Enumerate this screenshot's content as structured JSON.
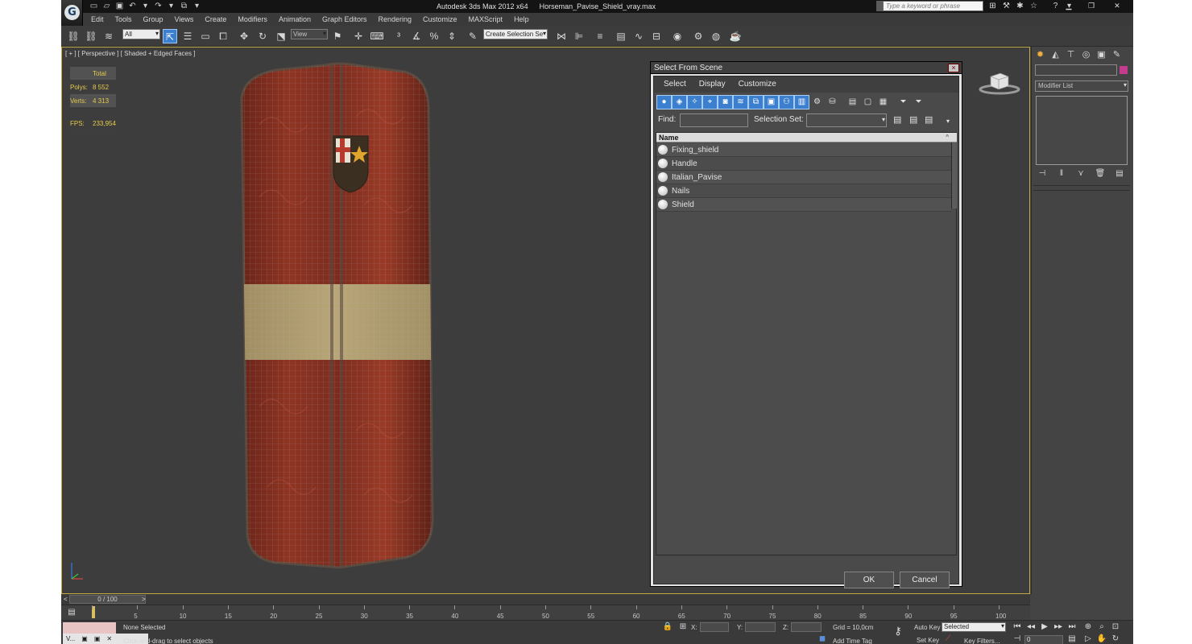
{
  "window": {
    "app_title": "Autodesk 3ds Max  2012 x64",
    "file_title": "Horseman_Pavise_Shield_vray.max",
    "search_placeholder": "Type a keyword or phrase"
  },
  "menu": [
    "Edit",
    "Tools",
    "Group",
    "Views",
    "Create",
    "Modifiers",
    "Animation",
    "Graph Editors",
    "Rendering",
    "Customize",
    "MAXScript",
    "Help"
  ],
  "toolbar": {
    "selection_filter": "All",
    "ref_coord": "View",
    "named_selection": "Create Selection Se"
  },
  "viewport": {
    "label": "[ + ] [ Perspective ] [ Shaded + Edged Faces ]",
    "stats": {
      "header": "Total",
      "polys_label": "Polys:",
      "polys_value": "8 552",
      "verts_label": "Verts:",
      "verts_value": "4 313",
      "fps_label": "FPS:",
      "fps_value": "233,954"
    }
  },
  "dialog": {
    "title": "Select From Scene",
    "close": "×",
    "menu": [
      "Select",
      "Display",
      "Customize"
    ],
    "find_label": "Find:",
    "selection_set_label": "Selection Set:",
    "column_header": "Name",
    "objects": [
      "Fixing_shield",
      "Handle",
      "Italian_Pavise",
      "Nails",
      "Shield"
    ],
    "ok": "OK",
    "cancel": "Cancel"
  },
  "command_panel": {
    "modifier_list": "Modifier List",
    "swatch_color": "#c23b8c"
  },
  "timeline": {
    "frame": "0 / 100",
    "ticks": [
      "5",
      "10",
      "15",
      "20",
      "25",
      "30",
      "35",
      "40",
      "45",
      "50",
      "55",
      "60",
      "65",
      "70",
      "75",
      "80",
      "85",
      "90",
      "95",
      "100"
    ]
  },
  "status": {
    "selection": "None Selected",
    "prompt": "Click-and-drag to select objects",
    "x_label": "X:",
    "y_label": "Y:",
    "z_label": "Z:",
    "grid": "Grid = 10,0cm",
    "add_time_tag": "Add Time Tag",
    "auto_key": "Auto Key",
    "set_key": "Set Key",
    "key_mode": "Selected",
    "key_filters": "Key Filters...",
    "current_frame": "0",
    "script_tab": "V..."
  },
  "colors": {
    "accent": "#3d7fcf",
    "viewport_border": "#c4a845",
    "stats": "#e6cb4a"
  }
}
